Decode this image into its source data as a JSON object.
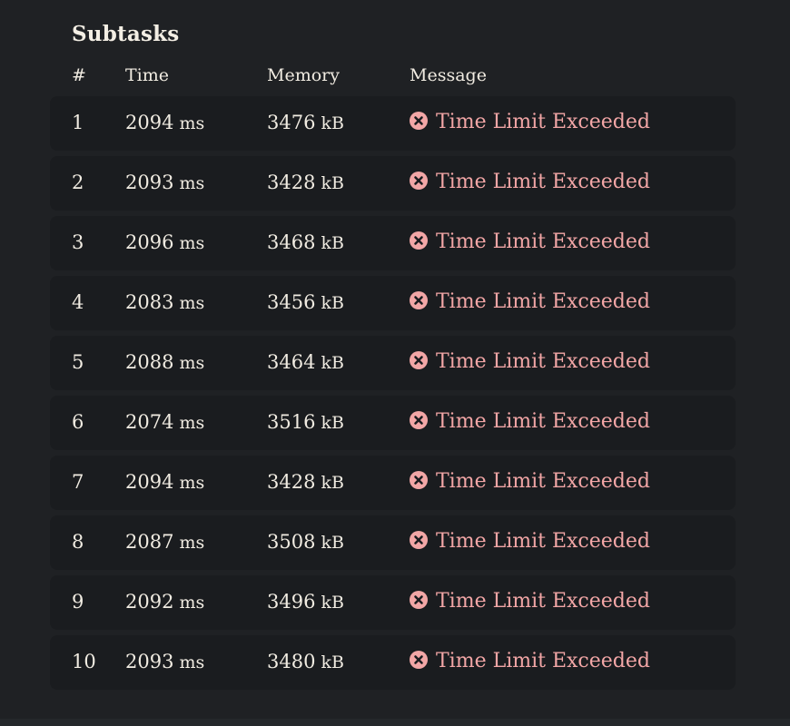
{
  "section": {
    "title": "Subtasks"
  },
  "table": {
    "headers": {
      "num": "#",
      "time": "Time",
      "memory": "Memory",
      "message": "Message"
    },
    "rows": [
      {
        "num": "1",
        "time": "2094",
        "time_unit": "ms",
        "memory": "3476",
        "memory_unit": "kB",
        "message": "Time Limit Exceeded"
      },
      {
        "num": "2",
        "time": "2093",
        "time_unit": "ms",
        "memory": "3428",
        "memory_unit": "kB",
        "message": "Time Limit Exceeded"
      },
      {
        "num": "3",
        "time": "2096",
        "time_unit": "ms",
        "memory": "3468",
        "memory_unit": "kB",
        "message": "Time Limit Exceeded"
      },
      {
        "num": "4",
        "time": "2083",
        "time_unit": "ms",
        "memory": "3456",
        "memory_unit": "kB",
        "message": "Time Limit Exceeded"
      },
      {
        "num": "5",
        "time": "2088",
        "time_unit": "ms",
        "memory": "3464",
        "memory_unit": "kB",
        "message": "Time Limit Exceeded"
      },
      {
        "num": "6",
        "time": "2074",
        "time_unit": "ms",
        "memory": "3516",
        "memory_unit": "kB",
        "message": "Time Limit Exceeded"
      },
      {
        "num": "7",
        "time": "2094",
        "time_unit": "ms",
        "memory": "3428",
        "memory_unit": "kB",
        "message": "Time Limit Exceeded"
      },
      {
        "num": "8",
        "time": "2087",
        "time_unit": "ms",
        "memory": "3508",
        "memory_unit": "kB",
        "message": "Time Limit Exceeded"
      },
      {
        "num": "9",
        "time": "2092",
        "time_unit": "ms",
        "memory": "3496",
        "memory_unit": "kB",
        "message": "Time Limit Exceeded"
      },
      {
        "num": "10",
        "time": "2093",
        "time_unit": "ms",
        "memory": "3480",
        "memory_unit": "kB",
        "message": "Time Limit Exceeded"
      }
    ]
  },
  "icons": {
    "status": "error-circle-x-icon"
  },
  "colors": {
    "background": "#1f2124",
    "row_background": "#1a1c1f",
    "text": "#f1ece2",
    "error": "#f2a6a6"
  }
}
